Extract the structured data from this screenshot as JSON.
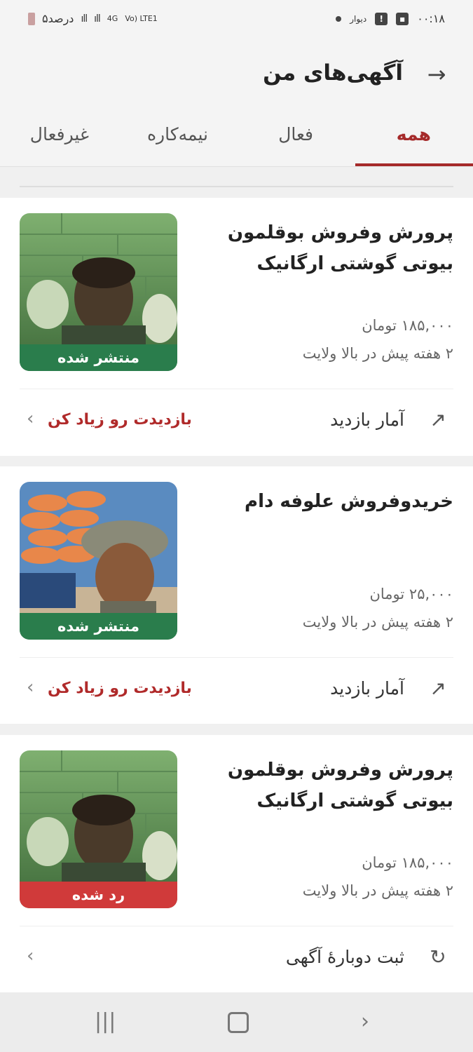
{
  "status_bar": {
    "time": "۰۰:۱۸",
    "app_label": "دیوار",
    "battery_text": "۵درصد",
    "network": "4G",
    "volte": "Vo) LTE1"
  },
  "header": {
    "title": "آگهی‌های من",
    "back_icon": "arrow-right-icon"
  },
  "tabs": [
    {
      "label": "همه",
      "active": true
    },
    {
      "label": "فعال",
      "active": false
    },
    {
      "label": "نیمه‌کاره",
      "active": false
    },
    {
      "label": "غیرفعال",
      "active": false
    }
  ],
  "ads": [
    {
      "title": "پرورش وفروش بوقلمون بیوتی گوشتی ارگانیک",
      "price": "۱۸۵,۰۰۰ تومان",
      "meta": "۲ هفته پیش در بالا ولایت",
      "status": "منتشر شده",
      "action_label": "آمار بازدید",
      "boost_label": "بازدیدت رو زیاد کن"
    },
    {
      "title": "خریدوفروش علوفه دام",
      "price": "۲۵,۰۰۰ تومان",
      "meta": "۲ هفته پیش در بالا ولایت",
      "status": "منتشر شده",
      "action_label": "آمار بازدید",
      "boost_label": "بازدیدت رو زیاد کن"
    },
    {
      "title": "پرورش وفروش بوقلمون بیوتی گوشتی ارگانیک",
      "price": "۱۸۵,۰۰۰ تومان",
      "meta": "۲ هفته پیش در بالا ولایت",
      "status": "رد شده",
      "action_label": "ثبت دوبارهٔ آگهی"
    }
  ],
  "colors": {
    "accent": "#a52a2a",
    "published": "#2a7d4c",
    "rejected": "#d03a3a"
  }
}
